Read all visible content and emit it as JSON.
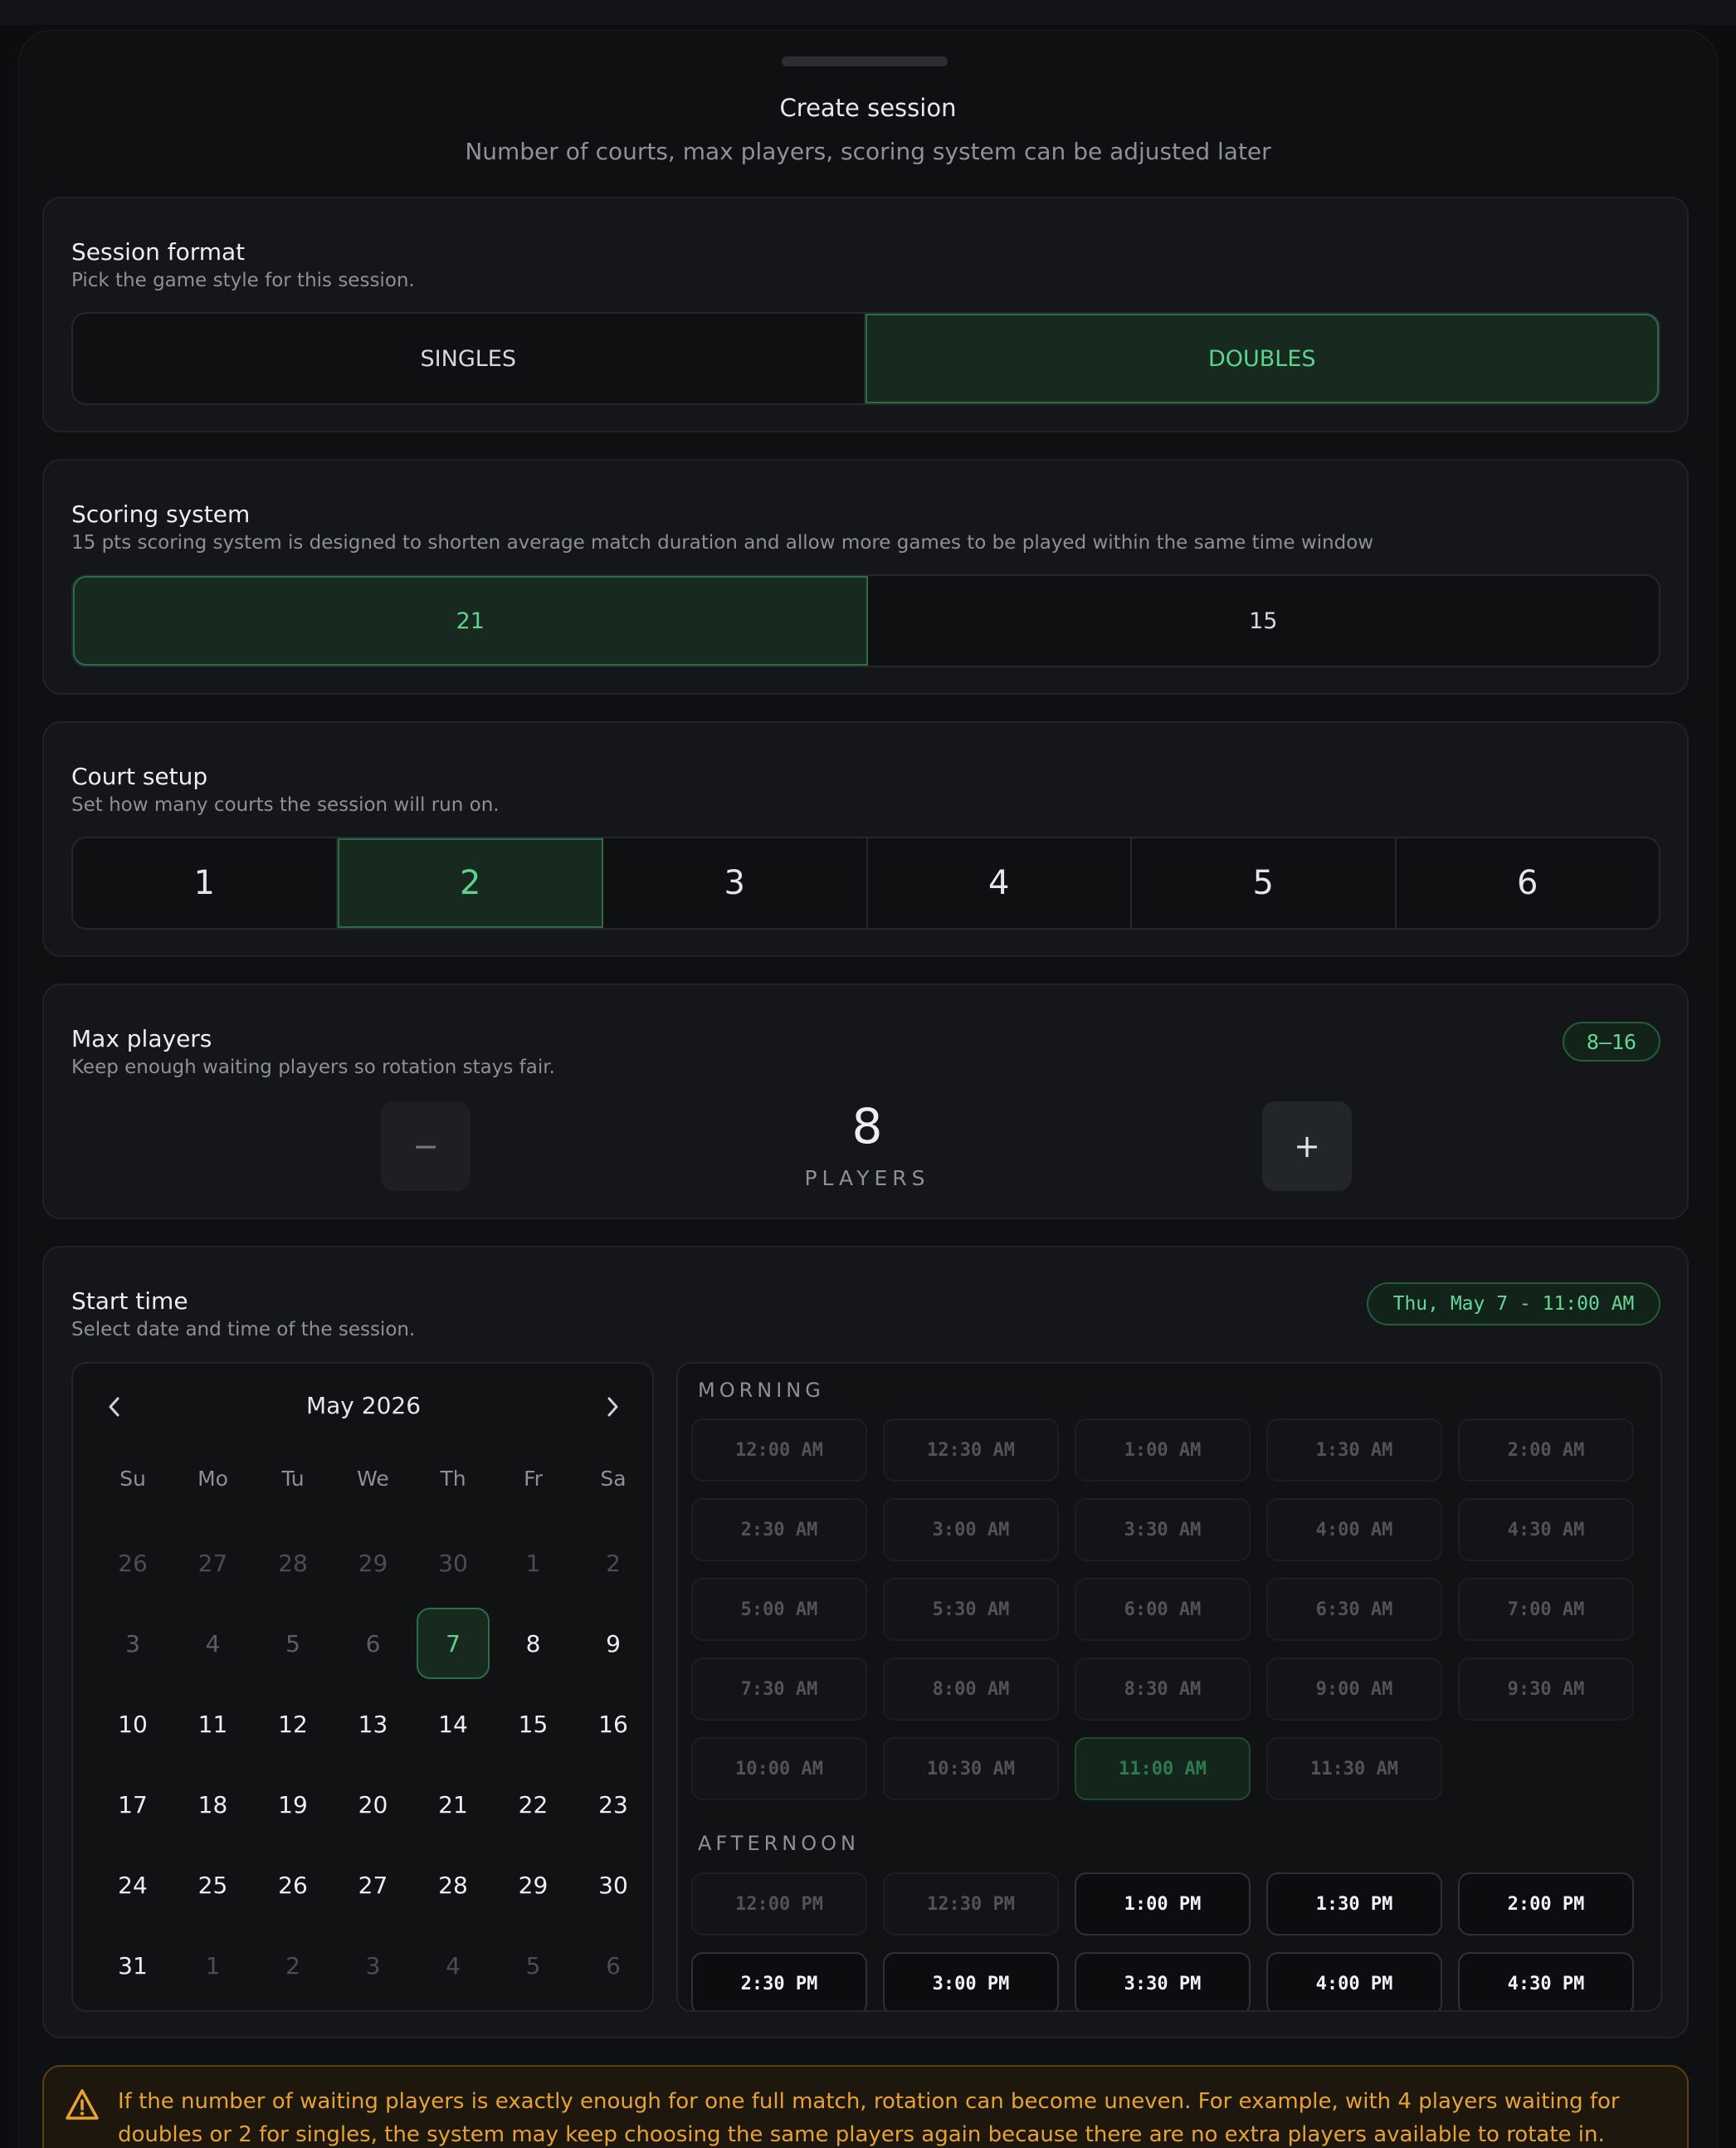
{
  "header": {
    "title": "Create session",
    "subtitle": "Number of courts, max players, scoring system can be adjusted later"
  },
  "format": {
    "title": "Session format",
    "subtitle": "Pick the game style for this session.",
    "options": [
      "SINGLES",
      "DOUBLES"
    ],
    "selected": "DOUBLES"
  },
  "scoring": {
    "title": "Scoring system",
    "subtitle": "15 pts scoring system is designed to shorten average match duration and allow more games to be played within the same time window",
    "options": [
      "21",
      "15"
    ],
    "selected": "21"
  },
  "courts": {
    "title": "Court setup",
    "subtitle": "Set how many courts the session will run on.",
    "options": [
      "1",
      "2",
      "3",
      "4",
      "5",
      "6"
    ],
    "selected": "2"
  },
  "players": {
    "title": "Max players",
    "subtitle": "Keep enough waiting players so rotation stays fair.",
    "range_badge": "8–16",
    "minus_label": "−",
    "plus_label": "+",
    "count": "8",
    "unit_label": "PLAYERS"
  },
  "start_time": {
    "title": "Start time",
    "subtitle": "Select date and time of the session.",
    "summary_badge": "Thu, May 7 - 11:00 AM",
    "calendar": {
      "month_label": "May 2026",
      "prev_icon": "chevron-left-icon",
      "next_icon": "chevron-right-icon",
      "weekdays": [
        "Su",
        "Mo",
        "Tu",
        "We",
        "Th",
        "Fr",
        "Sa"
      ],
      "weeks": [
        [
          [
            "26",
            "muted"
          ],
          [
            "27",
            "muted"
          ],
          [
            "28",
            "muted"
          ],
          [
            "29",
            "muted"
          ],
          [
            "30",
            "muted"
          ],
          [
            "1",
            "muted"
          ],
          [
            "2",
            "muted"
          ]
        ],
        [
          [
            "3",
            "disabled"
          ],
          [
            "4",
            "disabled"
          ],
          [
            "5",
            "disabled"
          ],
          [
            "6",
            "disabled"
          ],
          [
            "7",
            "selected"
          ],
          [
            "8",
            "normal"
          ],
          [
            "9",
            "normal"
          ]
        ],
        [
          [
            "10",
            "normal"
          ],
          [
            "11",
            "normal"
          ],
          [
            "12",
            "normal"
          ],
          [
            "13",
            "normal"
          ],
          [
            "14",
            "normal"
          ],
          [
            "15",
            "normal"
          ],
          [
            "16",
            "normal"
          ]
        ],
        [
          [
            "17",
            "normal"
          ],
          [
            "18",
            "normal"
          ],
          [
            "19",
            "normal"
          ],
          [
            "20",
            "normal"
          ],
          [
            "21",
            "normal"
          ],
          [
            "22",
            "normal"
          ],
          [
            "23",
            "normal"
          ]
        ],
        [
          [
            "24",
            "normal"
          ],
          [
            "25",
            "normal"
          ],
          [
            "26",
            "normal"
          ],
          [
            "27",
            "normal"
          ],
          [
            "28",
            "normal"
          ],
          [
            "29",
            "normal"
          ],
          [
            "30",
            "normal"
          ]
        ],
        [
          [
            "31",
            "normal"
          ],
          [
            "1",
            "muted"
          ],
          [
            "2",
            "muted"
          ],
          [
            "3",
            "muted"
          ],
          [
            "4",
            "muted"
          ],
          [
            "5",
            "muted"
          ],
          [
            "6",
            "muted"
          ]
        ]
      ]
    },
    "morning_label": "MORNING",
    "morning_slots": [
      [
        "12:00 AM",
        "dis"
      ],
      [
        "12:30 AM",
        "dis"
      ],
      [
        "1:00 AM",
        "dis"
      ],
      [
        "1:30 AM",
        "dis"
      ],
      [
        "2:00 AM",
        "dis"
      ],
      [
        "2:30 AM",
        "dis"
      ],
      [
        "3:00 AM",
        "dis"
      ],
      [
        "3:30 AM",
        "dis"
      ],
      [
        "4:00 AM",
        "dis"
      ],
      [
        "4:30 AM",
        "dis"
      ],
      [
        "5:00 AM",
        "dis"
      ],
      [
        "5:30 AM",
        "dis"
      ],
      [
        "6:00 AM",
        "dis"
      ],
      [
        "6:30 AM",
        "dis"
      ],
      [
        "7:00 AM",
        "dis"
      ],
      [
        "7:30 AM",
        "dis"
      ],
      [
        "8:00 AM",
        "dis"
      ],
      [
        "8:30 AM",
        "dis"
      ],
      [
        "9:00 AM",
        "dis"
      ],
      [
        "9:30 AM",
        "dis"
      ],
      [
        "10:00 AM",
        "dis"
      ],
      [
        "10:30 AM",
        "dis"
      ],
      [
        "11:00 AM",
        "sel"
      ],
      [
        "11:30 AM",
        "dis"
      ]
    ],
    "afternoon_label": "AFTERNOON",
    "afternoon_slots": [
      [
        "12:00 PM",
        "dis"
      ],
      [
        "12:30 PM",
        "dis"
      ],
      [
        "1:00 PM",
        "en"
      ],
      [
        "1:30 PM",
        "en"
      ],
      [
        "2:00 PM",
        "en"
      ],
      [
        "2:30 PM",
        "en"
      ],
      [
        "3:00 PM",
        "en"
      ],
      [
        "3:30 PM",
        "en"
      ],
      [
        "4:00 PM",
        "en"
      ],
      [
        "4:30 PM",
        "en"
      ]
    ]
  },
  "warning": {
    "icon": "warning-triangle-icon",
    "text": "If the number of waiting players is exactly enough for one full match, rotation can become uneven. For example, with 4 players waiting for doubles or 2 for singles, the system may keep choosing the same players again because there are no extra players available to rotate in."
  },
  "colors": {
    "accent": "#5ed38d",
    "warning": "#e7a235",
    "background": "#0c0d0f"
  }
}
